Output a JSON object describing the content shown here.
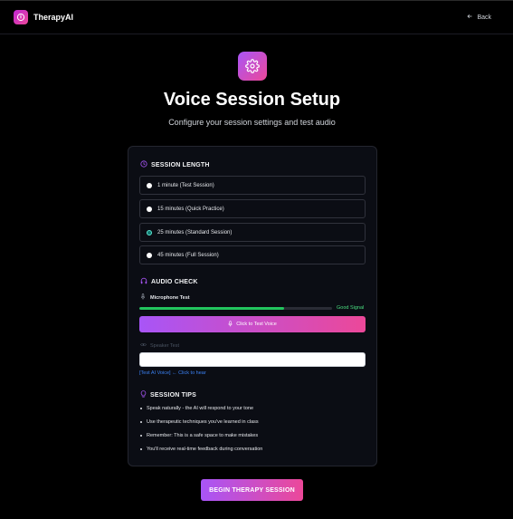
{
  "header": {
    "brand_name": "TherapyAI",
    "back_label": "Back"
  },
  "hero": {
    "title": "Voice Session Setup",
    "subtitle": "Configure your session settings and test audio"
  },
  "session_length": {
    "heading": "SESSION LENGTH",
    "options": [
      {
        "label": "1 minute (Test Session)",
        "selected": false
      },
      {
        "label": "15 minutes (Quick Practice)",
        "selected": false
      },
      {
        "label": "25 minutes (Standard Session)",
        "selected": true
      },
      {
        "label": "45 minutes (Full Session)",
        "selected": false
      }
    ]
  },
  "audio_check": {
    "heading": "AUDIO CHECK",
    "mic_label": "Microphone Test",
    "mic_level_percent": 75,
    "signal_text": "Good Signal",
    "test_voice_label": "Click to Test Voice",
    "speaker_label": "Speaker Test",
    "speaker_link": "[Test AI Voice] ← Click to hear"
  },
  "tips": {
    "heading": "SESSION TIPS",
    "items": [
      "Speak naturally - the AI will respond to your tone",
      "Use therapeutic techniques you've learned in class",
      "Remember: This is a safe space to make mistakes",
      "You'll receive real-time feedback during conversation"
    ]
  },
  "actions": {
    "begin_label": "BEGIN THERAPY SESSION"
  },
  "colors": {
    "accent_start": "#a855f7",
    "accent_end": "#ec4899",
    "signal_green": "#22c55e",
    "link_blue": "#3b82f6"
  },
  "icons": {
    "brand": "power-circle-icon",
    "back": "arrow-left-icon",
    "hero": "gear-icon",
    "session_length": "clock-icon",
    "audio_check": "headphones-icon",
    "mic": "microphone-icon",
    "speaker": "eye-icon",
    "tips": "lightbulb-icon"
  }
}
